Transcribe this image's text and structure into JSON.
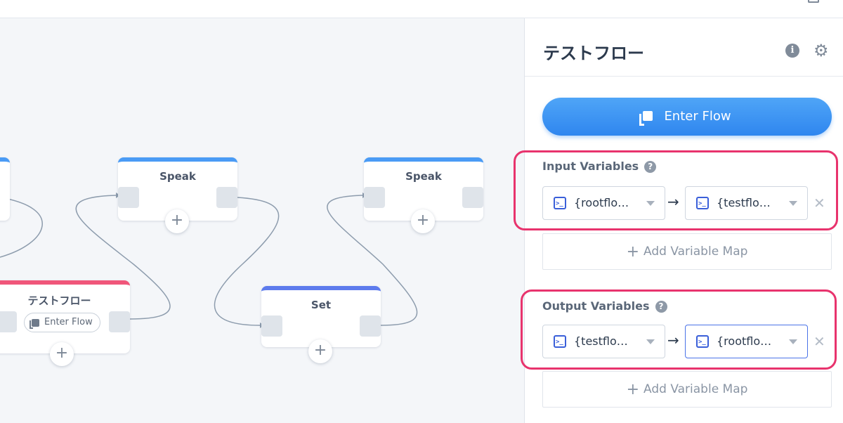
{
  "canvas": {
    "nodes": {
      "speak1": {
        "title": "Speak",
        "color": "#4a9bf5"
      },
      "speak2": {
        "title": "Speak",
        "color": "#4a9bf5"
      },
      "flow": {
        "title": "テストフロー",
        "color": "#f0567a",
        "chip": "Enter Flow"
      },
      "set": {
        "title": "Set",
        "color": "#5d7bed"
      }
    },
    "add_symbol": "+"
  },
  "panel": {
    "title": "テストフロー",
    "enter_flow_label": "Enter Flow",
    "input": {
      "label": "Input Variables",
      "help": "?",
      "from": "{rootflo…",
      "to": "{testflo…",
      "arrow": "→",
      "remove": "✕",
      "add_map": "Add Variable Map"
    },
    "output": {
      "label": "Output Variables",
      "help": "?",
      "from": "{testflo…",
      "to": "{rootflo…",
      "arrow": "→",
      "remove": "✕",
      "add_map": "Add Variable Map"
    }
  },
  "colors": {
    "accent": "#2f86ef",
    "highlight": "#e8336d",
    "flow_node": "#f0567a"
  }
}
